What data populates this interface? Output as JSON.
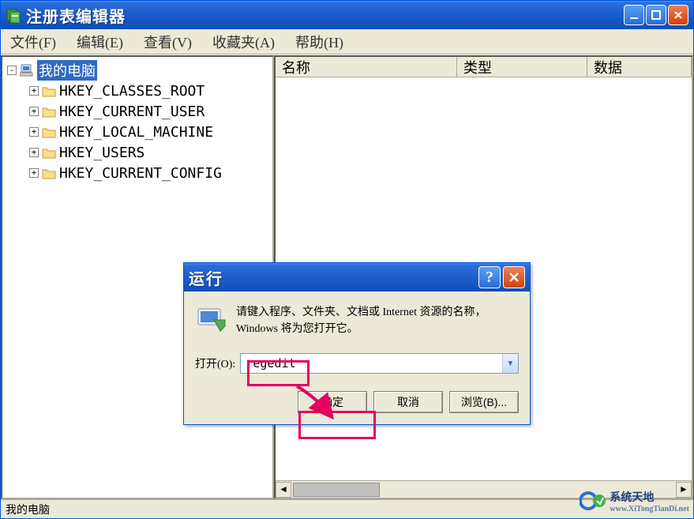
{
  "window": {
    "title": "注册表编辑器",
    "minimize": "_",
    "maximize": "□",
    "close": "X"
  },
  "menu": {
    "file": "文件(F)",
    "edit": "编辑(E)",
    "view": "查看(V)",
    "favorites": "收藏夹(A)",
    "help": "帮助(H)"
  },
  "tree": {
    "root": "我的电脑",
    "expand_minus": "-",
    "expand_plus": "+",
    "keys": [
      "HKEY_CLASSES_ROOT",
      "HKEY_CURRENT_USER",
      "HKEY_LOCAL_MACHINE",
      "HKEY_USERS",
      "HKEY_CURRENT_CONFIG"
    ]
  },
  "columns": {
    "name": "名称",
    "type": "类型",
    "data": "数据"
  },
  "statusbar": "我的电脑",
  "run": {
    "title": "运行",
    "help": "?",
    "close": "X",
    "description": "请键入程序、文件夹、文档或 Internet 资源的名称，Windows 将为您打开它。",
    "open_label": "打开(O):",
    "value": "regedit",
    "ok": "确定",
    "cancel": "取消",
    "browse": "浏览(B)..."
  },
  "icons": {
    "regedit": "regedit-icon",
    "computer": "computer-icon",
    "folder": "folder-icon",
    "run": "run-icon"
  },
  "watermark": {
    "title": "系统天地",
    "url": "www.XiTongTianDi.net"
  },
  "colors": {
    "highlight": "#e60060",
    "titlebar": "#1c5bc8"
  }
}
